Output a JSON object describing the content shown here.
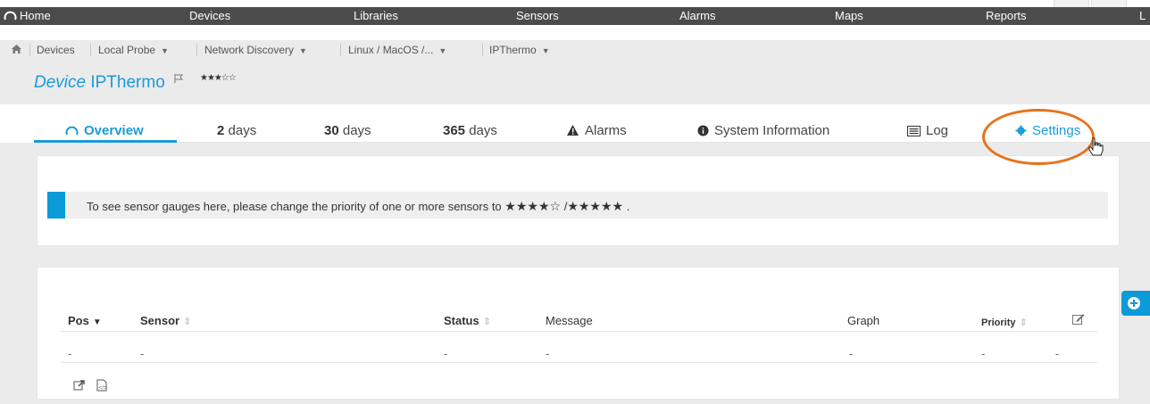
{
  "nav": {
    "home": "Home",
    "devices": "Devices",
    "libraries": "Libraries",
    "sensors": "Sensors",
    "alarms": "Alarms",
    "maps": "Maps",
    "reports": "Reports",
    "more": "L"
  },
  "breadcrumb": {
    "devices": "Devices",
    "probe": "Local Probe",
    "group": "Network Discovery",
    "subgroup": "Linux / MacOS /...",
    "device": "IPThermo"
  },
  "device": {
    "type_label": "Device",
    "name": "IPThermo",
    "stars": "★★★☆☆"
  },
  "tabs": {
    "overview": "Overview",
    "days2_num": "2",
    "days2_unit": "days",
    "days30_num": "30",
    "days30_unit": "days",
    "days365_num": "365",
    "days365_unit": "days",
    "alarms": "Alarms",
    "sysinfo": "System Information",
    "log": "Log",
    "settings": "Settings"
  },
  "notice": {
    "text": "To see sensor gauges here, please change the priority of one or more sensors to",
    "stars4": "★★★★☆",
    "sep": "/",
    "stars5": "★★★★★",
    "end": "."
  },
  "table": {
    "headers": {
      "pos": "Pos",
      "sensor": "Sensor",
      "status": "Status",
      "message": "Message",
      "graph": "Graph",
      "priority": "Priority"
    },
    "row": {
      "pos": "-",
      "sensor": "-",
      "status": "-",
      "message": "-",
      "graph": "-",
      "priority": "-",
      "extra": "-"
    }
  },
  "colors": {
    "accent": "#1a9bd8",
    "nav_bg": "#4b4b4b",
    "highlight_ring": "#e8731e"
  }
}
